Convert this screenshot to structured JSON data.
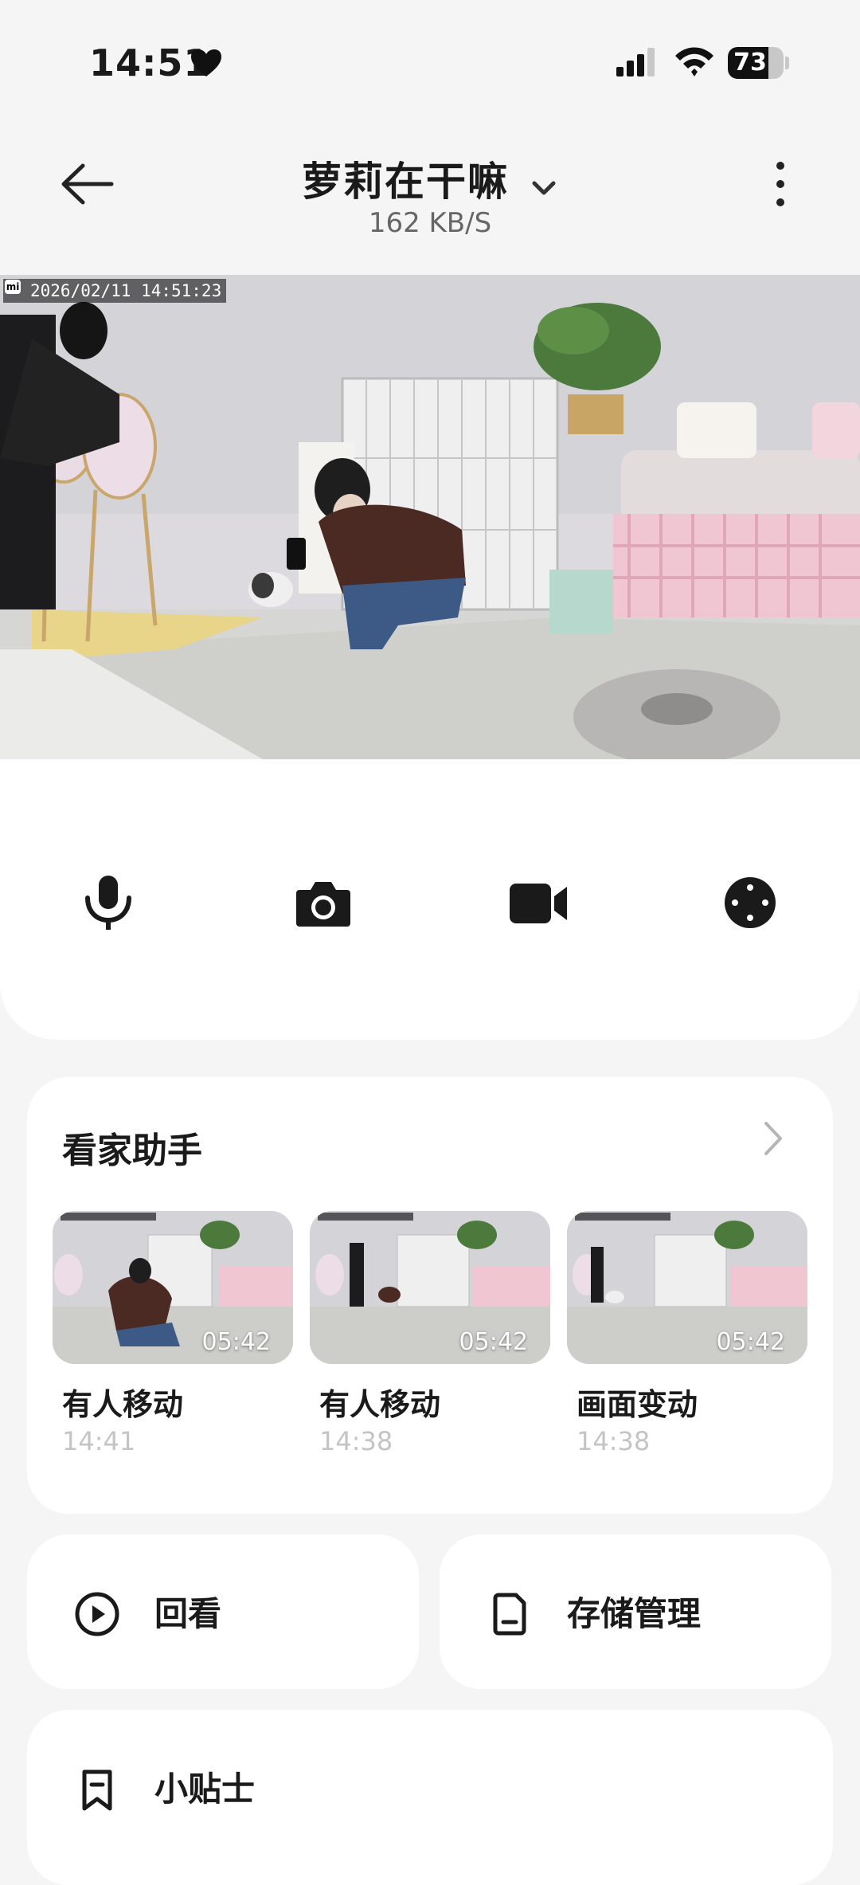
{
  "status_bar": {
    "time": "14:51",
    "battery": "73",
    "battery_level": 0.73
  },
  "header": {
    "title": "萝莉在干嘛",
    "bitrate": "162 KB/S"
  },
  "camera": {
    "timestamp": "2026/02/11 14:51:23"
  },
  "controls": {
    "icons": [
      "microphone-icon",
      "camera-icon",
      "video-record-icon",
      "direction-pad-icon"
    ]
  },
  "assistant": {
    "title": "看家助手",
    "events": [
      {
        "label": "有人移动",
        "time": "14:41",
        "duration": "05:42"
      },
      {
        "label": "有人移动",
        "time": "14:38",
        "duration": "05:42"
      },
      {
        "label": "画面变动",
        "time": "14:38",
        "duration": "05:42"
      }
    ]
  },
  "actions": {
    "playback": "回看",
    "storage": "存储管理",
    "tips": "小贴士"
  }
}
